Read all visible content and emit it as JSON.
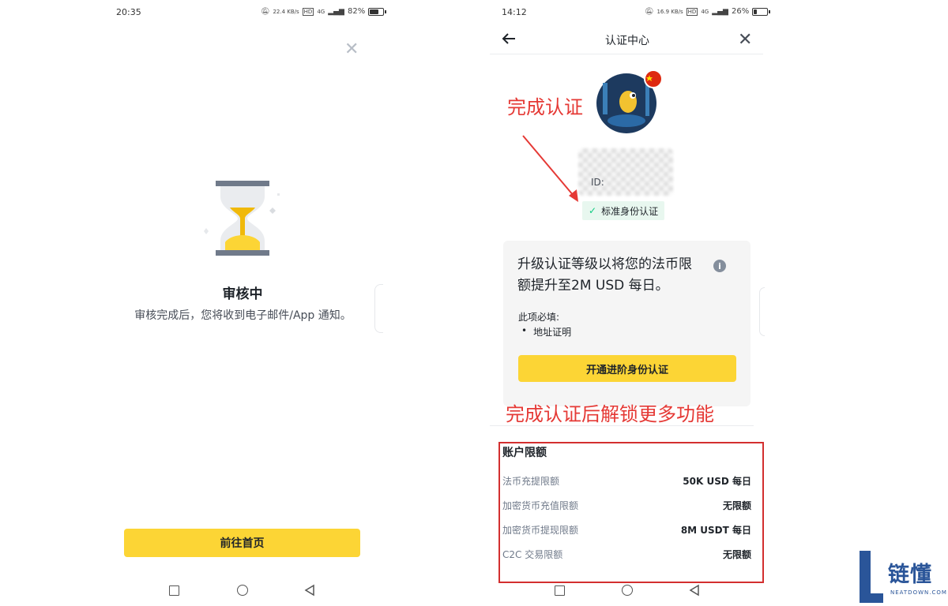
{
  "left": {
    "status_time": "20:35",
    "status_net_speed": "22.4 KB/s",
    "status_hd": "HD",
    "status_signal": "4G",
    "status_battery": "82%",
    "battery_level": 0.82,
    "title": "审核中",
    "subtitle": "审核完成后，您将收到电子邮件/App 通知。",
    "home_button": "前往首页"
  },
  "right": {
    "status_time": "14:12",
    "status_net_speed": "16.9 KB/s",
    "status_hd": "HD",
    "status_signal": "4G",
    "status_battery": "26%",
    "battery_level": 0.26,
    "header_title": "认证中心",
    "annotation_top": "完成认证",
    "id_label": "ID:",
    "verified_badge": "标准身份认证",
    "upgrade_title": "升级认证等级以将您的法币限额提升至2M USD 每日。",
    "required_label": "此项必填:",
    "required_item": "地址证明",
    "upgrade_button": "开通进阶身份认证",
    "annotation_bottom": "完成认证后解锁更多功能",
    "limits_title": "账户限额",
    "limits": [
      {
        "label": "法币充提限额",
        "value": "50K USD 每日"
      },
      {
        "label": "加密货币充值限额",
        "value": "无限额"
      },
      {
        "label": "加密货币提现限额",
        "value": "8M USDT 每日"
      },
      {
        "label": "C2C 交易限额",
        "value": "无限额"
      }
    ]
  },
  "watermark": {
    "text": "链懂",
    "domain": "NEATDOWN.COM"
  },
  "colors": {
    "accent_yellow": "#fcd535",
    "annotation_red": "#e53935",
    "verified_green": "#0ecb81"
  }
}
